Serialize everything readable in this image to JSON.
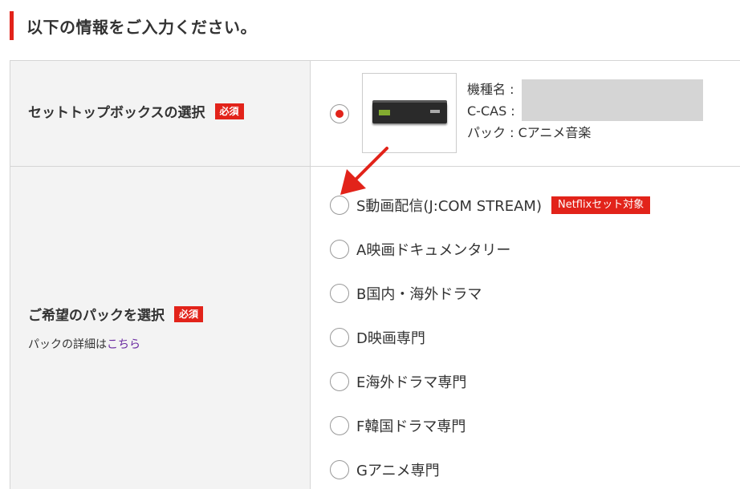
{
  "heading": "以下の情報をご入力ください。",
  "stb_section": {
    "label": "セットトップボックスの選択",
    "required": "必須",
    "info": {
      "model_label": "機種名 :",
      "ccas_label": "C-CAS :",
      "pack_line": "パック : Cアニメ音楽"
    }
  },
  "pack_section": {
    "label": "ご希望のパックを選択",
    "required": "必須",
    "note_prefix": "パックの詳細は",
    "note_link": "こちら",
    "options": [
      {
        "label": "S動画配信(J:COM STREAM)",
        "badge": "Netflixセット対象"
      },
      {
        "label": "A映画ドキュメンタリー"
      },
      {
        "label": "B国内・海外ドラマ"
      },
      {
        "label": "D映画専門"
      },
      {
        "label": "E海外ドラマ専門"
      },
      {
        "label": "F韓国ドラマ専門"
      },
      {
        "label": "Gアニメ専門"
      }
    ]
  },
  "colors": {
    "accent": "#e2231a",
    "link": "#6a2aa0"
  }
}
